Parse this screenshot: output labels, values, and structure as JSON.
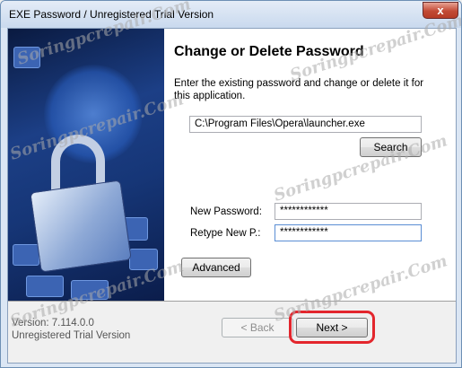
{
  "window": {
    "title": "EXE Password / Unregistered Trial Version",
    "close_glyph": "x"
  },
  "panel": {
    "heading": "Change or Delete Password",
    "description": "Enter the existing password and change or delete it for this application.",
    "path_value": "C:\\Program Files\\Opera\\launcher.exe",
    "search_label": "Search",
    "new_password_label": "New Password:",
    "new_password_value": "************",
    "retype_label": "Retype New P.:",
    "retype_value": "************",
    "advanced_label": "Advanced"
  },
  "footer": {
    "version": "Version: 7.114.0.0",
    "status": "Unregistered Trial Version",
    "back_label": "< Back",
    "next_label": "Next >"
  },
  "watermark": {
    "text": "Soringpcrepair.Com"
  },
  "colors": {
    "highlight": "#e3262d",
    "title_bar": "#c9d9ee"
  }
}
